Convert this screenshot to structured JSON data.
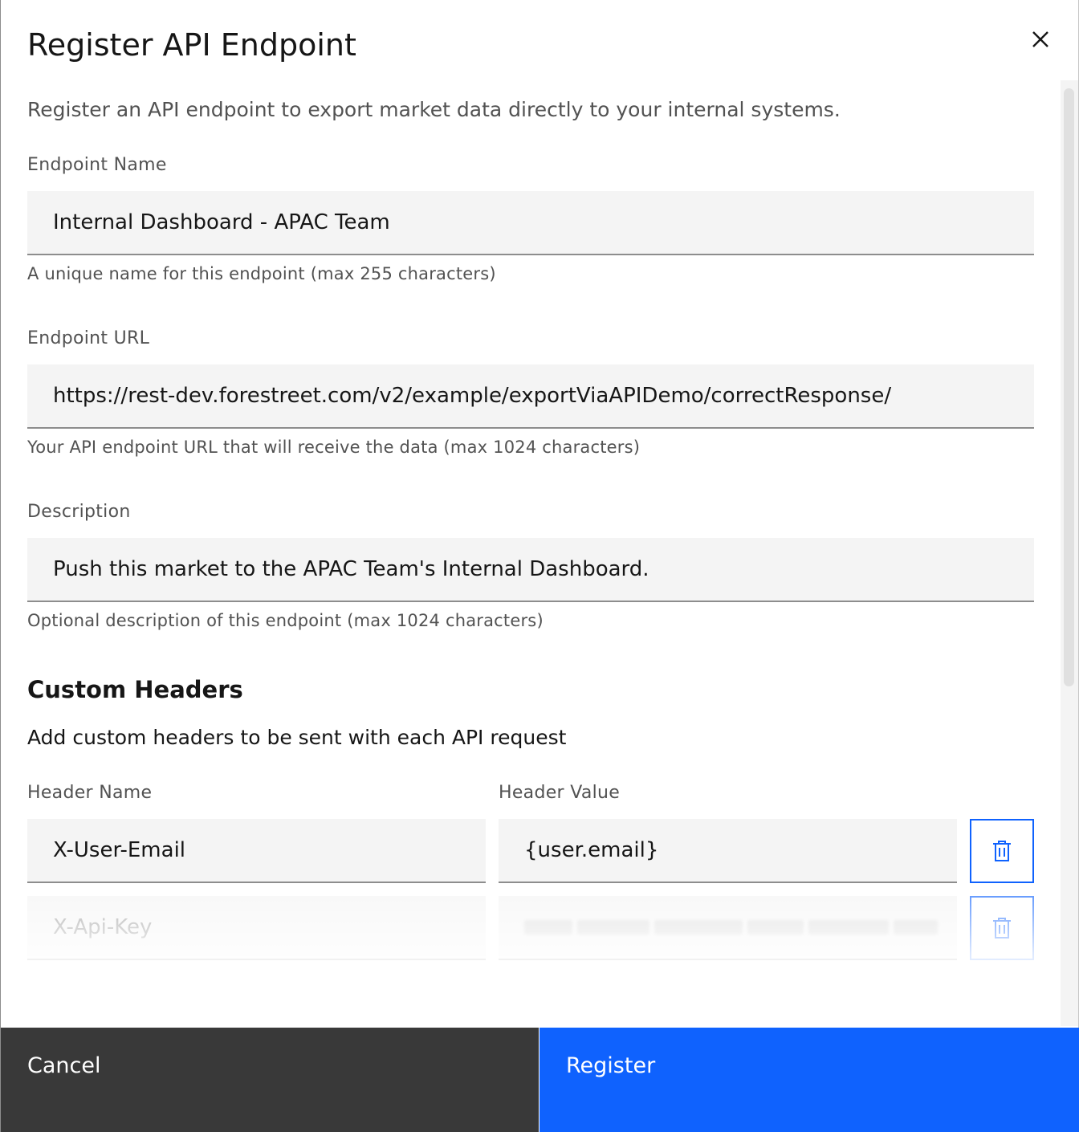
{
  "modal": {
    "title": "Register API Endpoint",
    "intro": "Register an API endpoint to export market data directly to your internal systems."
  },
  "fields": {
    "endpoint_name": {
      "label": "Endpoint Name",
      "value": "Internal Dashboard - APAC Team",
      "helper": "A unique name for this endpoint (max 255 characters)"
    },
    "endpoint_url": {
      "label": "Endpoint URL",
      "value": "https://rest-dev.forestreet.com/v2/example/exportViaAPIDemo/correctResponse/",
      "helper": "Your API endpoint URL that will receive the data (max 1024 characters)"
    },
    "description": {
      "label": "Description",
      "value": "Push this market to the APAC Team's Internal Dashboard.",
      "helper": "Optional description of this endpoint (max 1024 characters)"
    }
  },
  "custom_headers": {
    "title": "Custom Headers",
    "description": "Add custom headers to be sent with each API request",
    "name_label": "Header Name",
    "value_label": "Header Value",
    "rows": [
      {
        "name": "X-User-Email",
        "value": "{user.email}"
      },
      {
        "name": "X-Api-Key",
        "value": ""
      }
    ]
  },
  "footer": {
    "cancel_label": "Cancel",
    "register_label": "Register"
  },
  "colors": {
    "primary": "#0f62fe",
    "secondary_button": "#393939",
    "field_background": "#f4f4f4"
  },
  "icons": {
    "close": "close-icon",
    "delete": "trash-icon"
  }
}
